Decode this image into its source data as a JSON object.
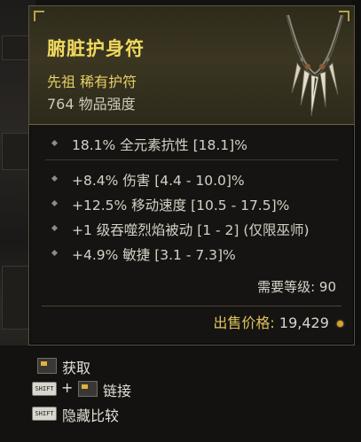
{
  "item": {
    "name": "腑脏护身符",
    "rarity_line": "先祖 稀有护符",
    "item_power": "764 物品强度",
    "implicit_stats": [
      "18.1% 全元素抗性 [18.1]%"
    ],
    "affixes": [
      "+8.4% 伤害 [4.4 - 10.0]%",
      "+12.5% 移动速度 [10.5 - 17.5]%",
      "+1 级吞噬烈焰被动 [1 - 2] (仅限巫师)",
      "+4.9% 敏捷 [3.1 - 7.3]%"
    ],
    "level_requirement": "需要等级: 90",
    "sell_label": "出售价格:",
    "sell_value": "19,429"
  },
  "actions": {
    "acquire_label": "获取",
    "plus_sign": "+",
    "link_label": "链接",
    "hide_compare_label": "隐藏比较",
    "shift_key": "SHIFT"
  },
  "colors": {
    "title": "#f0d95c",
    "rarity": "#e5cf63",
    "sell_label": "#e1c45a",
    "frame": "#5b5443"
  },
  "icons": [
    "necklace-icon",
    "mouse-icon",
    "shift-key-icon",
    "gold-coin-icon"
  ]
}
